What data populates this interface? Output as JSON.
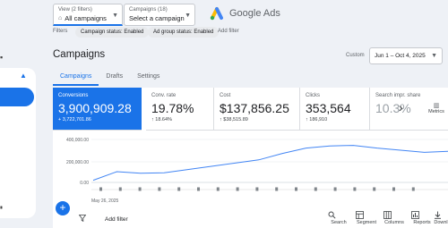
{
  "header": {
    "view_small": "View (2 filters)",
    "view_main": "All campaigns",
    "campaigns_small": "Campaigns (18)",
    "campaigns_main": "Select a campaign",
    "brand": "Google Ads"
  },
  "filters": {
    "label": "Filters",
    "chips": [
      "Campaign status: Enabled",
      "Ad group status: Enabled"
    ],
    "add_filter": "Add filter"
  },
  "page": {
    "title": "Campaigns",
    "date_label": "Custom",
    "date_range": "Jun 1 – Oct 4, 2025"
  },
  "tabs": [
    "Campaigns",
    "Drafts",
    "Settings"
  ],
  "scorecards": [
    {
      "label": "Conversions",
      "value": "3,900,909.28",
      "sub": "+ 3,722,701.86"
    },
    {
      "label": "Conv. rate",
      "value": "19.78%",
      "sub": "18.64%"
    },
    {
      "label": "Cost",
      "value": "$137,856.25",
      "sub": "$38,515.89"
    },
    {
      "label": "Clicks",
      "value": "353,564",
      "sub": "186,910"
    },
    {
      "label": "Search impr. share",
      "value": "10.3%",
      "sub": ""
    }
  ],
  "metrics_button": "Metrics",
  "chart_data": {
    "type": "line",
    "y_ticks": [
      "400,000.00",
      "200,000.00",
      "0.00"
    ],
    "ylim": [
      0,
      500000
    ],
    "x_label_start": "May 26, 2025",
    "series": [
      {
        "values": [
          20000,
          100000,
          85000,
          90000,
          120000,
          150000,
          180000,
          210000,
          270000,
          320000,
          340000,
          345000,
          320000,
          300000,
          280000,
          290000
        ]
      }
    ]
  },
  "toolbar": {
    "add_filter": "Add filter",
    "tools": [
      "Search",
      "Segment",
      "Columns",
      "Reports",
      "Downl"
    ]
  },
  "colors": {
    "accent": "#1a73e8",
    "chart_line": "#4285f4"
  }
}
